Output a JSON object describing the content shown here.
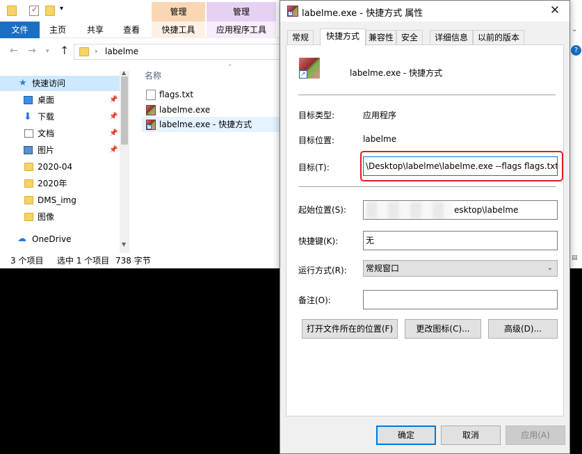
{
  "explorer": {
    "context_tab_groups": [
      "管理",
      "管理"
    ],
    "ribbon_tabs": [
      "文件",
      "主页",
      "共享",
      "查看",
      "快捷工具",
      "应用程序工具"
    ],
    "address": {
      "path": "labelme"
    },
    "sidebar": {
      "items": [
        {
          "label": "快速访问",
          "icon": "star-icon",
          "pinned": false
        },
        {
          "label": "桌面",
          "icon": "desktop-icon",
          "pinned": true
        },
        {
          "label": "下载",
          "icon": "download-icon",
          "pinned": true
        },
        {
          "label": "文档",
          "icon": "document-icon",
          "pinned": true
        },
        {
          "label": "图片",
          "icon": "picture-icon",
          "pinned": true
        },
        {
          "label": "2020-04",
          "icon": "folder-icon",
          "pinned": false
        },
        {
          "label": "2020年",
          "icon": "folder-icon",
          "pinned": false
        },
        {
          "label": "DMS_img",
          "icon": "folder-icon",
          "pinned": false
        },
        {
          "label": "图像",
          "icon": "folder-icon",
          "pinned": false
        },
        {
          "label": "OneDrive",
          "icon": "cloud-icon",
          "pinned": false
        }
      ]
    },
    "filelist": {
      "column_header": "名称",
      "files": [
        {
          "name": "flags.txt",
          "icon": "text-file-icon"
        },
        {
          "name": "labelme.exe",
          "icon": "exe-icon"
        },
        {
          "name": "labelme.exe - 快捷方式",
          "icon": "shortcut-icon"
        }
      ]
    },
    "status": {
      "count": "3 个项目",
      "selection": "选中 1 个项目",
      "size": "738 字节"
    }
  },
  "dialog": {
    "title": "labelme.exe - 快捷方式 属性",
    "tabs": [
      "常规",
      "快捷方式",
      "兼容性",
      "安全",
      "详细信息",
      "以前的版本"
    ],
    "active_tab": "快捷方式",
    "shortcut_name": "labelme.exe - 快捷方式",
    "target_type_label": "目标类型:",
    "target_type_value": "应用程序",
    "target_location_label": "目标位置:",
    "target_location_value": "labelme",
    "target_label": "目标(T):",
    "target_value": "\\Desktop\\labelme\\labelme.exe --flags flags.txt",
    "start_in_label": "起始位置(S):",
    "start_in_value": "esktop\\labelme",
    "hotkey_label": "快捷键(K):",
    "hotkey_value": "无",
    "run_label": "运行方式(R):",
    "run_value": "常规窗口",
    "comment_label": "备注(O):",
    "comment_value": "",
    "open_location_button": "打开文件所在的位置(F)",
    "change_icon_button": "更改图标(C)...",
    "advanced_button": "高级(D)...",
    "ok_button": "确定",
    "cancel_button": "取消",
    "apply_button": "应用(A)"
  }
}
